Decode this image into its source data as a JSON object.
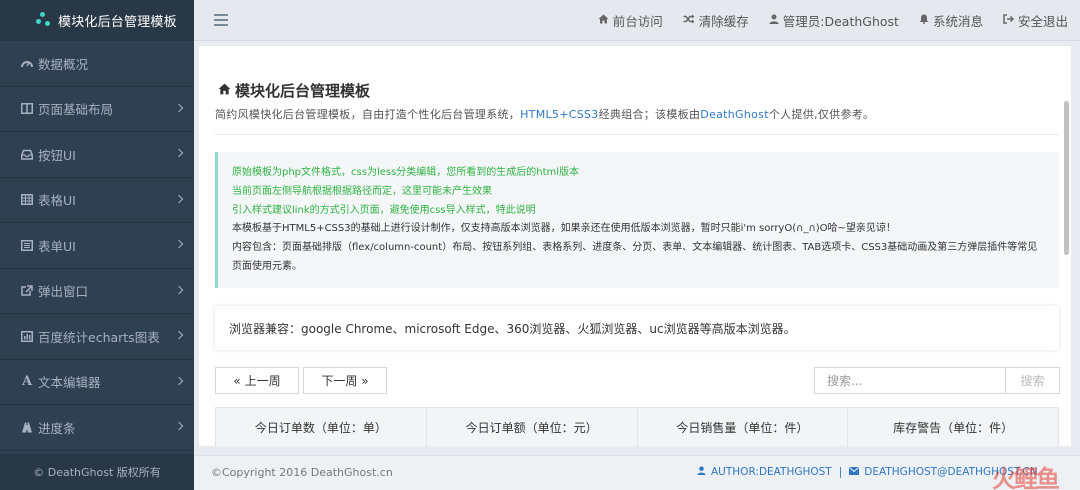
{
  "app": {
    "brand": "模块化后台管理模板",
    "footer": "© DeathGhost 版权所有"
  },
  "sidebar": {
    "items": [
      {
        "label": "数据概况",
        "icon": "dashboard-icon",
        "has_children": false
      },
      {
        "label": "页面基础布局",
        "icon": "columns-icon",
        "has_children": true
      },
      {
        "label": "按钮UI",
        "icon": "inbox-icon",
        "has_children": true
      },
      {
        "label": "表格UI",
        "icon": "table-icon",
        "has_children": true
      },
      {
        "label": "表单UI",
        "icon": "list-alt-icon",
        "has_children": true
      },
      {
        "label": "弹出窗口",
        "icon": "external-link-icon",
        "has_children": true
      },
      {
        "label": "百度统计echarts图表",
        "icon": "bar-chart-icon",
        "has_children": true
      },
      {
        "label": "文本编辑器",
        "icon": "font-icon",
        "has_children": true
      },
      {
        "label": "进度条",
        "icon": "road-icon",
        "has_children": true
      }
    ]
  },
  "topbar": {
    "items": [
      {
        "label": "前台访问",
        "icon": "home-icon"
      },
      {
        "label": "清除缓存",
        "icon": "random-icon"
      },
      {
        "label": "管理员:DeathGhost",
        "icon": "user-icon"
      },
      {
        "label": "系统消息",
        "icon": "bell-icon"
      },
      {
        "label": "安全退出",
        "icon": "sign-out-icon"
      }
    ]
  },
  "main": {
    "title": "模块化后台管理模板",
    "desc_pre": "简约风模快化后台管理模板，自由打造个性化后台管理系统，",
    "desc_hl1": "HTML5+CSS3",
    "desc_mid": "经典组合；该模板由",
    "desc_hl2": "DeathGhost",
    "desc_post": "个人提供,仅供参考。",
    "notice": {
      "line1": "原始模板为php文件格式，css为less分类编辑，您所看到的生成后的html版本",
      "line2": "当前页面左侧导航根据根据路径而定，这里可能未产生效果",
      "line3": "引入样式建议link的方式引入页面，避免使用css导入样式，特此说明",
      "line4": "本模板基于HTML5+CSS3的基础上进行设计制作，仅支持高版本浏览器，如果亲还在使用低版本浏览器，暂时只能i'm sorryO(∩_∩)O哈~望亲见谅！",
      "line5": "内容包含：页面基础排版（flex/column-count）布局、按钮系列组、表格系列、进度条、分页、表单、文本编辑器、统计图表、TAB选项卡、CSS3基础动画及第三方弹层插件等常见页面使用元素。"
    },
    "compat": "浏览器兼容：google Chrome、microsoft Edge、360浏览器、火狐浏览器、uc浏览器等高版本浏览器。",
    "pager": {
      "prev": "« 上一周",
      "next": "下一周 »"
    },
    "search": {
      "placeholder": "搜索...",
      "button": "搜索"
    },
    "table": {
      "headers": [
        "今日订单数（单位：单）",
        "今日订单额（单位：元）",
        "今日销售量（单位：件）",
        "库存警告（单位：件）"
      ]
    }
  },
  "footer": {
    "copyright": "©Copyright 2016 DeathGhost.cn",
    "author": "AUTHOR:DEATHGHOST",
    "sep": "|",
    "email": "DEATHGHOST@DEATHGHOST.CN",
    "watermark": "火鲤鱼"
  }
}
